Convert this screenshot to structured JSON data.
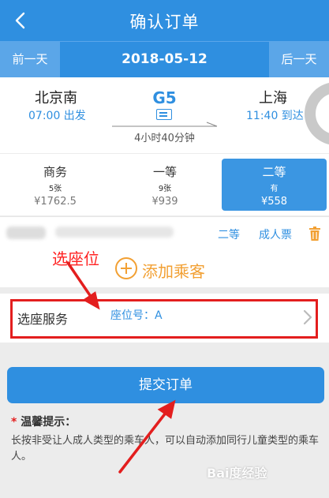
{
  "header": {
    "title": "确认订单"
  },
  "date_nav": {
    "prev_label": "前一天",
    "date": "2018-05-12",
    "next_label": "后一天"
  },
  "train": {
    "from_station": "北京南",
    "from_time": "07:00 出发",
    "number": "G5",
    "to_station": "上海",
    "to_time": "11:40 到达",
    "duration": "4小时40分钟"
  },
  "seats": [
    {
      "class": "商务",
      "count": "5张",
      "price": "¥1762.5"
    },
    {
      "class": "一等",
      "count": "9张",
      "price": "¥939"
    },
    {
      "class": "二等",
      "count": "有",
      "price": "¥558"
    }
  ],
  "passenger": {
    "seat_class": "二等",
    "ticket_type": "成人票"
  },
  "add_passenger": {
    "label": "添加乘客"
  },
  "annotations": {
    "choose_seat": "选座位"
  },
  "seat_service": {
    "label": "选座服务",
    "value": "座位号：A"
  },
  "submit": {
    "label": "提交订单"
  },
  "tips": {
    "title": "温馨提示：",
    "body": "长按非受让人成人类型的乘车人，可以自动添加同行儿童类型的乘车人。"
  },
  "watermark": "Bai度经验",
  "colors": {
    "primary": "#2f8fe0",
    "accent": "#f2a033",
    "annotation": "#e31e1e"
  }
}
